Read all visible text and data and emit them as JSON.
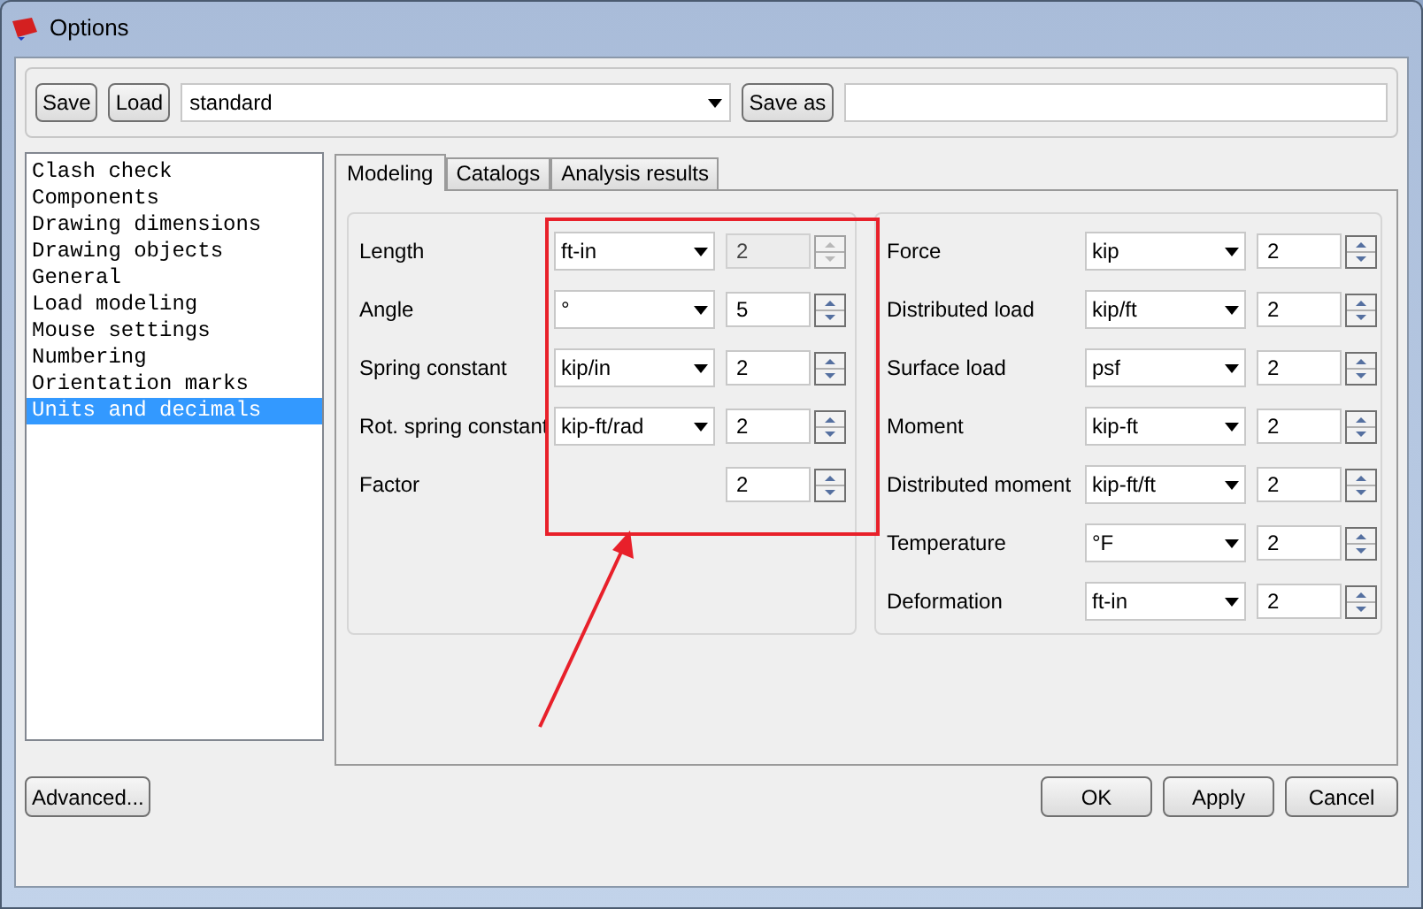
{
  "window": {
    "title": "Options"
  },
  "toolbar": {
    "save": "Save",
    "load": "Load",
    "preset": "standard",
    "save_as": "Save as"
  },
  "categories": [
    {
      "label": "Clash check",
      "selected": false
    },
    {
      "label": "Components",
      "selected": false
    },
    {
      "label": "Drawing dimensions",
      "selected": false
    },
    {
      "label": "Drawing objects",
      "selected": false
    },
    {
      "label": "General",
      "selected": false
    },
    {
      "label": "Load modeling",
      "selected": false
    },
    {
      "label": "Mouse settings",
      "selected": false
    },
    {
      "label": "Numbering",
      "selected": false
    },
    {
      "label": "Orientation marks",
      "selected": false
    },
    {
      "label": "Units and decimals",
      "selected": true
    }
  ],
  "tabs": [
    {
      "label": "Modeling",
      "selected": true
    },
    {
      "label": "Catalogs",
      "selected": false
    },
    {
      "label": "Analysis results",
      "selected": false
    }
  ],
  "left_units": [
    {
      "label": "Length",
      "unit": "ft-in",
      "decimals": "2",
      "disabled": true
    },
    {
      "label": "Angle",
      "unit": "°",
      "decimals": "5",
      "disabled": false
    },
    {
      "label": "Spring constant",
      "unit": "kip/in",
      "decimals": "2",
      "disabled": false
    },
    {
      "label": "Rot. spring constant",
      "unit": "kip-ft/rad",
      "decimals": "2",
      "disabled": false
    },
    {
      "label": "Factor",
      "decimals": "2",
      "disabled": false
    }
  ],
  "right_units": [
    {
      "label": "Force",
      "unit": "kip",
      "decimals": "2",
      "disabled": false
    },
    {
      "label": "Distributed load",
      "unit": "kip/ft",
      "decimals": "2",
      "disabled": false
    },
    {
      "label": "Surface load",
      "unit": "psf",
      "decimals": "2",
      "disabled": false
    },
    {
      "label": "Moment",
      "unit": "kip-ft",
      "decimals": "2",
      "disabled": false
    },
    {
      "label": "Distributed moment",
      "unit": "kip-ft/ft",
      "decimals": "2",
      "disabled": false
    },
    {
      "label": "Temperature",
      "unit": "°F",
      "decimals": "2",
      "disabled": false
    },
    {
      "label": "Deformation",
      "unit": "ft-in",
      "decimals": "2",
      "disabled": false
    }
  ],
  "buttons": {
    "advanced": "Advanced...",
    "ok": "OK",
    "apply": "Apply",
    "cancel": "Cancel"
  }
}
